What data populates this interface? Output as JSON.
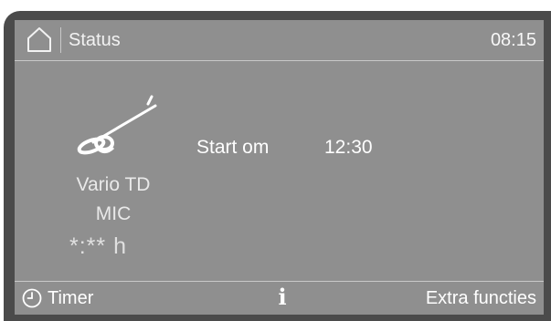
{
  "header": {
    "home_icon": "home-icon",
    "title": "Status",
    "clock": "08:15"
  },
  "program": {
    "icon": "spiral-instrument-icon",
    "name": "Vario TD",
    "subtitle": "MIC",
    "duration": "*:** h"
  },
  "start": {
    "label": "Start om",
    "time": "12:30"
  },
  "footer": {
    "timer_icon": "clock-icon",
    "timer_label": "Timer",
    "info_icon": "info-icon",
    "info_glyph": "i",
    "extra_label": "Extra functies"
  },
  "colors": {
    "screen_bg": "#8f8f8f",
    "frame": "#4b4b4b",
    "text": "#ffffff",
    "divider": "#c8c8c8"
  }
}
